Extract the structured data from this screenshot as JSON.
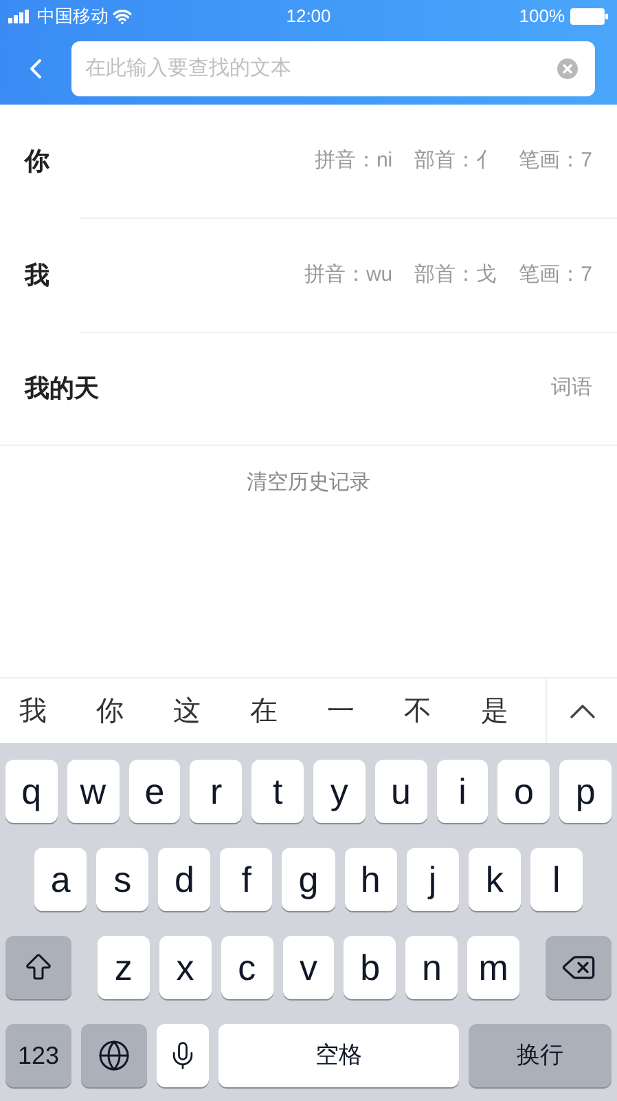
{
  "status_bar": {
    "carrier": "中国移动",
    "time": "12:00",
    "battery": "100%"
  },
  "search": {
    "placeholder": "在此输入要查找的文本"
  },
  "history": [
    {
      "title": "你",
      "details": [
        "拼音：ni",
        "部首：亻",
        "笔画：7"
      ]
    },
    {
      "title": "我",
      "details": [
        "拼音：wu",
        "部首：戈",
        "笔画：7"
      ]
    },
    {
      "title": "我的天",
      "details": [
        "词语"
      ]
    }
  ],
  "clear_history": "清空历史记录",
  "candidates": [
    "我",
    "你",
    "这",
    "在",
    "一",
    "不",
    "是"
  ],
  "keyboard": {
    "letter_rows": [
      [
        {
          "kind": "letter",
          "label": "q"
        },
        {
          "kind": "letter",
          "label": "w"
        },
        {
          "kind": "letter",
          "label": "e"
        },
        {
          "kind": "letter",
          "label": "r"
        },
        {
          "kind": "letter",
          "label": "t"
        },
        {
          "kind": "letter",
          "label": "y"
        },
        {
          "kind": "letter",
          "label": "u"
        },
        {
          "kind": "letter",
          "label": "i"
        },
        {
          "kind": "letter",
          "label": "o"
        },
        {
          "kind": "letter",
          "label": "p"
        }
      ],
      [
        {
          "kind": "letter",
          "label": "a"
        },
        {
          "kind": "letter",
          "label": "s"
        },
        {
          "kind": "letter",
          "label": "d"
        },
        {
          "kind": "letter",
          "label": "f"
        },
        {
          "kind": "letter",
          "label": "g"
        },
        {
          "kind": "letter",
          "label": "h"
        },
        {
          "kind": "letter",
          "label": "j"
        },
        {
          "kind": "letter",
          "label": "k"
        },
        {
          "kind": "letter",
          "label": "l"
        }
      ],
      [
        {
          "kind": "shift"
        },
        {
          "kind": "letter",
          "label": "z"
        },
        {
          "kind": "letter",
          "label": "x"
        },
        {
          "kind": "letter",
          "label": "c"
        },
        {
          "kind": "letter",
          "label": "v"
        },
        {
          "kind": "letter",
          "label": "b"
        },
        {
          "kind": "letter",
          "label": "n"
        },
        {
          "kind": "letter",
          "label": "m"
        },
        {
          "kind": "delete"
        }
      ]
    ],
    "bottom_row": [
      {
        "kind": "numbers",
        "label": "123"
      },
      {
        "kind": "globe"
      },
      {
        "kind": "mic"
      },
      {
        "kind": "space",
        "label": "空格"
      },
      {
        "kind": "return",
        "label": "换行"
      }
    ]
  }
}
